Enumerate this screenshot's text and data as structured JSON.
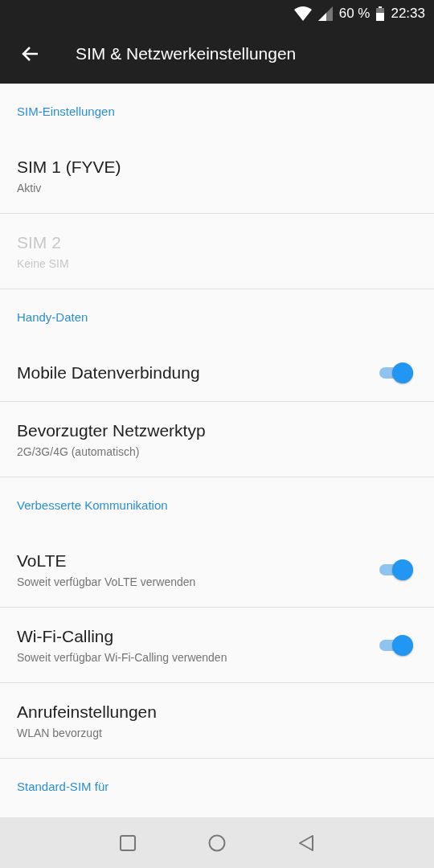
{
  "status_bar": {
    "battery": "60 %",
    "time": "22:33"
  },
  "toolbar": {
    "title": "SIM & Netzwerkeinstellungen"
  },
  "list": [
    {
      "kind": "header",
      "title": "SIM-Einstellungen"
    },
    {
      "kind": "text",
      "title": "SIM 1  (FYVE)",
      "subtitle": "Aktiv",
      "disabled": false
    },
    {
      "kind": "text",
      "title": "SIM 2",
      "subtitle": "Keine SIM",
      "disabled": true
    },
    {
      "kind": "header",
      "title": "Handy-Daten"
    },
    {
      "kind": "switch",
      "title": "Mobile Datenverbindung",
      "disabled": false,
      "on": true
    },
    {
      "kind": "text",
      "title": "Bevorzugter Netzwerktyp",
      "subtitle": "2G/3G/4G (automatisch)",
      "disabled": false
    },
    {
      "kind": "header",
      "title": "Verbesserte Kommunikation"
    },
    {
      "kind": "switch",
      "title": "VoLTE",
      "subtitle": "Soweit verfügbar VoLTE verwenden",
      "disabled": false,
      "on": true
    },
    {
      "kind": "switch",
      "title": "Wi-Fi-Calling",
      "subtitle": "Soweit verfügbar Wi-Fi-Calling verwenden",
      "disabled": false,
      "on": true
    },
    {
      "kind": "text",
      "title": "Anrufeinstellungen",
      "subtitle": "WLAN bevorzugt",
      "disabled": false
    },
    {
      "kind": "header",
      "title": "Standard-SIM für"
    }
  ]
}
